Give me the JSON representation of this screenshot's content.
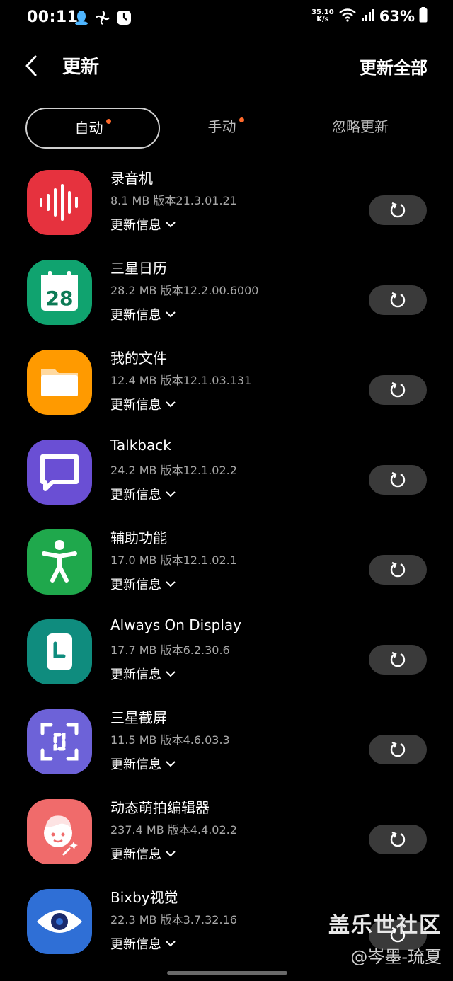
{
  "status_bar": {
    "time": "00:11",
    "net_speed_value": "35.10",
    "net_speed_unit": "K/s",
    "battery": "63%",
    "icons_left": [
      "qq-icon",
      "fan-icon",
      "clock-icon"
    ],
    "icons_right": [
      "wifi-icon",
      "signal-icon",
      "battery-icon"
    ]
  },
  "header": {
    "title": "更新",
    "update_all": "更新全部"
  },
  "tabs": [
    {
      "label": "自动",
      "active": true,
      "badge": true
    },
    {
      "label": "手动",
      "active": false,
      "badge": true
    },
    {
      "label": "忽略更新",
      "active": false,
      "badge": false
    }
  ],
  "apps": [
    {
      "name": "录音机",
      "meta": "8.1 MB  版本21.3.01.21",
      "info": "更新信息",
      "icon": "voice-recorder-icon",
      "color": "#e6323e"
    },
    {
      "name": "三星日历",
      "meta": "28.2 MB  版本12.2.00.6000",
      "info": "更新信息",
      "icon": "calendar-icon",
      "color": "#10a36f",
      "icon_text": "28"
    },
    {
      "name": "我的文件",
      "meta": "12.4 MB  版本12.1.03.131",
      "info": "更新信息",
      "icon": "folder-icon",
      "color": "#ff9a00"
    },
    {
      "name": "Talkback",
      "meta": "24.2 MB  版本12.1.02.2",
      "info": "更新信息",
      "icon": "talkback-icon",
      "color": "#6a4fd4"
    },
    {
      "name": "辅助功能",
      "meta": "17.0 MB  版本12.1.02.1",
      "info": "更新信息",
      "icon": "accessibility-icon",
      "color": "#1fa84c"
    },
    {
      "name": "Always On Display",
      "meta": "17.7 MB  版本6.2.30.6",
      "info": "更新信息",
      "icon": "aod-clock-icon",
      "color": "#0f8c7e"
    },
    {
      "name": "三星截屏",
      "meta": "11.5 MB  版本4.6.03.3",
      "info": "更新信息",
      "icon": "screenshot-icon",
      "color": "#6d62d8"
    },
    {
      "name": "动态萌拍编辑器",
      "meta": "237.4 MB  版本4.4.02.2",
      "info": "更新信息",
      "icon": "ar-emoji-icon",
      "color": "#f06b6b"
    },
    {
      "name": "Bixby视觉",
      "meta": "22.3 MB  版本3.7.32.16",
      "info": "更新信息",
      "icon": "bixby-vision-icon",
      "color": "#2f6fd6"
    }
  ],
  "watermark": {
    "line1": "盖乐世社区",
    "line2": "@岑墨-琉夏"
  }
}
